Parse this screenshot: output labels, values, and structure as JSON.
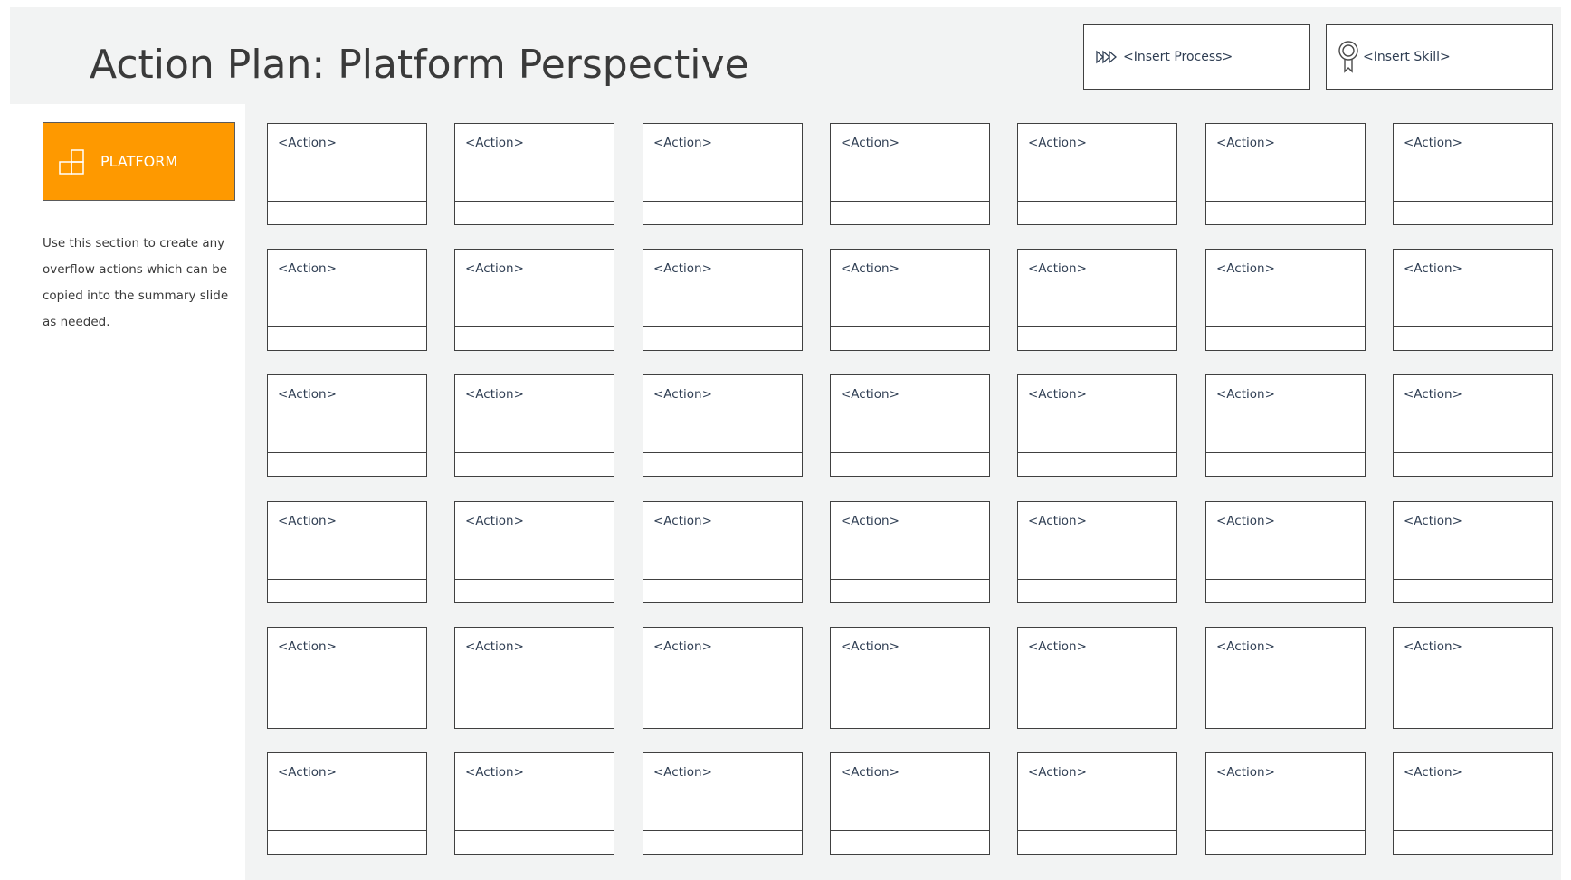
{
  "header": {
    "title": "Action Plan: Platform Perspective",
    "process_label": "<Insert Process>",
    "process_icon": "fast-forward-icon",
    "skill_label": "<Insert Skill>",
    "skill_icon": "award-ribbon-icon"
  },
  "sidebar": {
    "platform_label": "PLATFORM",
    "platform_icon": "platform-blocks-icon",
    "platform_color": "#fe9900",
    "description": "Use this section to create any overflow actions which can be copied into the summary slide as needed."
  },
  "grid": {
    "rows": 6,
    "columns": 7,
    "action_label": "<Action>"
  },
  "colors": {
    "background_panel": "#f2f3f3",
    "border": "#404040",
    "text_dark": "#3a3a3a",
    "text_label": "#2f3e53"
  }
}
